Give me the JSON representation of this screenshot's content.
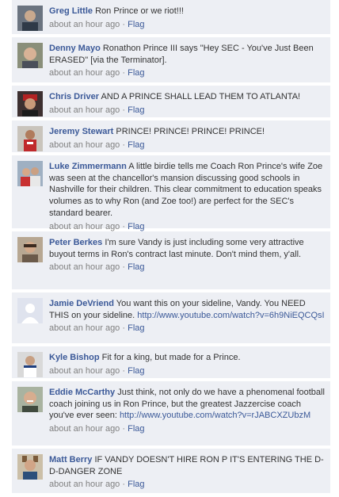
{
  "comments": [
    {
      "author": "Greg Little",
      "text": "Ron Prince or we riot!!!",
      "link": "",
      "time": "about an hour ago",
      "flag": "Flag"
    },
    {
      "author": "Denny Mayo",
      "text": "Ronathon Prince III says \"Hey SEC - You've Just Been ERASED\" [via the Terminator].",
      "link": "",
      "time": "about an hour ago",
      "flag": "Flag"
    },
    {
      "author": "Chris Driver",
      "text": "AND A PRINCE SHALL LEAD THEM TO ATLANTA!",
      "link": "",
      "time": "about an hour ago",
      "flag": "Flag"
    },
    {
      "author": "Jeremy Stewart",
      "text": "PRINCE! PRINCE! PRINCE! PRINCE!",
      "link": "",
      "time": "about an hour ago",
      "flag": "Flag"
    },
    {
      "author": "Luke Zimmermann",
      "text": "A little birdie tells me Coach Ron Prince's wife Zoe was seen at the chancellor's mansion discussing good schools in Nashville for their children. This clear commitment to education speaks volumes as to why Ron (and Zoe too!) are perfect for the SEC's standard bearer.",
      "link": "",
      "time": "about an hour ago",
      "flag": "Flag"
    },
    {
      "author": "Peter Berkes",
      "text": "I'm sure Vandy is just including some very attractive buyout terms in Ron's contract last minute. Don't mind them, y'all.",
      "link": "",
      "time": "about an hour ago",
      "flag": "Flag"
    },
    {
      "author": "Jamie DeVriend",
      "text": "You want this on your sideline, Vandy. You NEED THIS on your sideline.",
      "link": "http://www.youtube.com/watch?v=6h9NiEQCQsI",
      "time": "about an hour ago",
      "flag": "Flag"
    },
    {
      "author": "Kyle Bishop",
      "text": "Fit for a king, but made for a Prince.",
      "link": "",
      "time": "about an hour ago",
      "flag": "Flag"
    },
    {
      "author": "Eddie McCarthy",
      "text": "Just think, not only do we have a phenomenal football coach joining us in Ron Prince, but the greatest Jazzercise coach you've ever seen:",
      "link": "http://www.youtube.com/watch?v=rJABCXZUbzM",
      "time": "about an hour ago",
      "flag": "Flag"
    },
    {
      "author": "Matt Berry",
      "text": "IF VANDY DOESN'T HIRE RON P IT'S ENTERING THE D-D-DANGER ZONE",
      "link": "",
      "time": "about an hour ago",
      "flag": "Flag"
    }
  ],
  "meta_separator": "·",
  "colors": {
    "link": "#3b5998",
    "background": "#edeff4",
    "muted": "#808080"
  }
}
